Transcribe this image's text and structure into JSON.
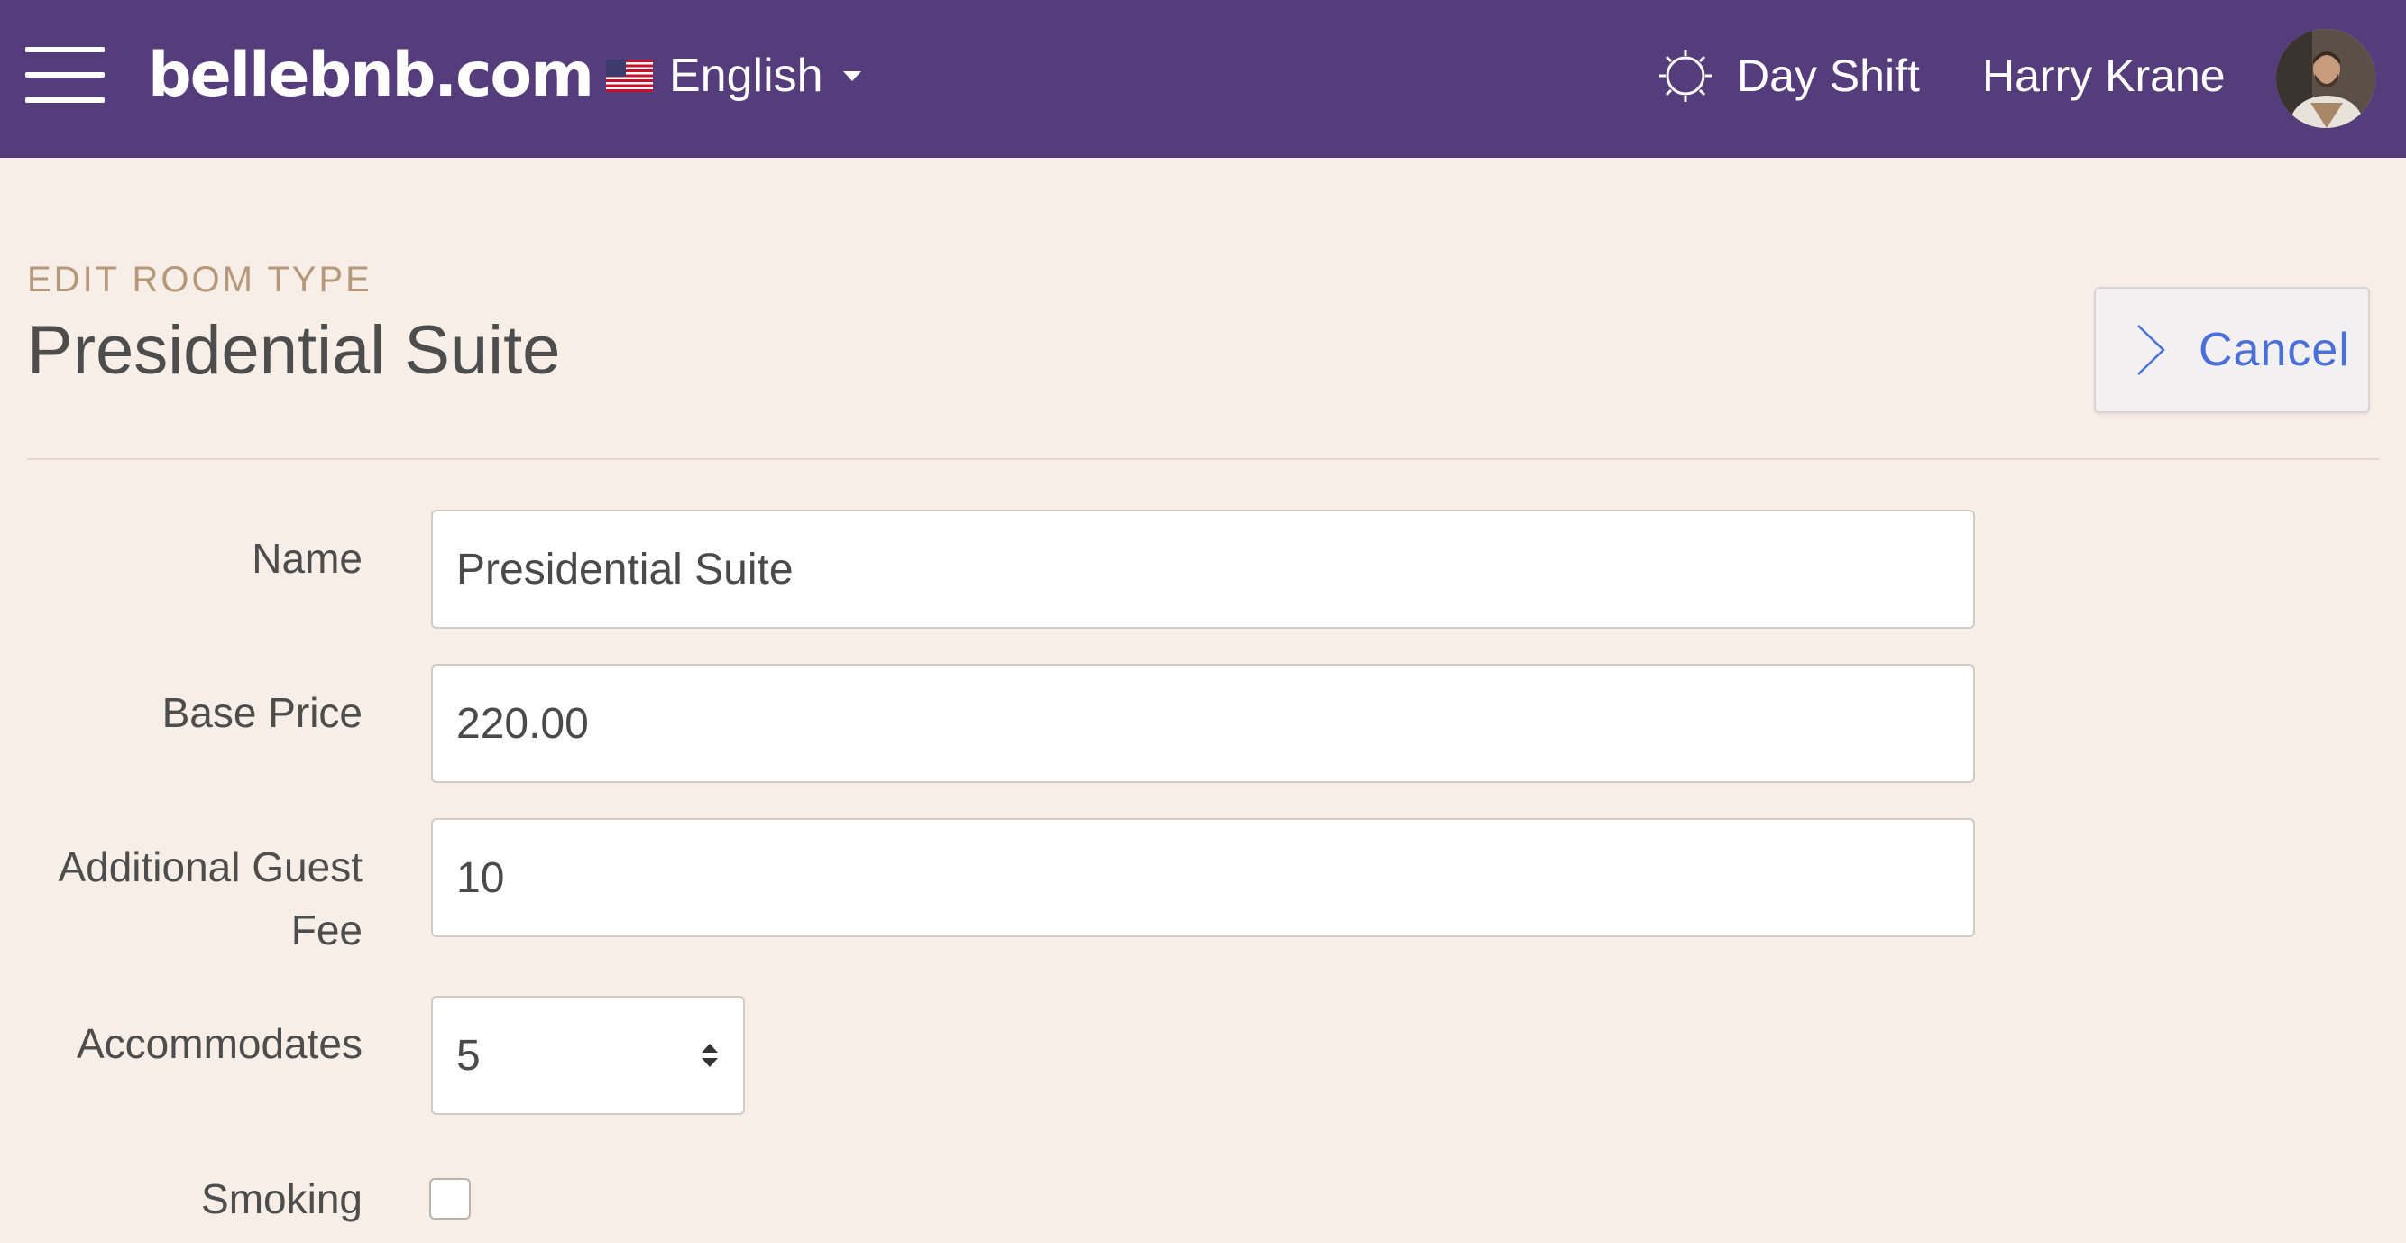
{
  "header": {
    "brand": "bellebnb.com",
    "language": "English",
    "shift": "Day Shift",
    "user_name": "Harry Krane",
    "icons": {
      "menu": "hamburger-menu-icon",
      "flag": "us-flag-icon",
      "shift": "sun-icon",
      "avatar": "user-avatar"
    },
    "colors": {
      "bar": "#553c7b",
      "text": "#ffffff"
    }
  },
  "page": {
    "eyebrow": "EDIT ROOM TYPE",
    "title": "Presidential Suite",
    "cancel_label": "Cancel",
    "colors": {
      "background": "#f7eee7",
      "accent": "#4a6fd8",
      "eyebrow": "#b5977a"
    }
  },
  "form": {
    "name": {
      "label": "Name",
      "value": "Presidential Suite"
    },
    "base_price": {
      "label": "Base Price",
      "value": "220.00"
    },
    "additional_guest_fee": {
      "label_line1": "Additional Guest",
      "label_line2": "Fee",
      "value": "10"
    },
    "accommodates": {
      "label": "Accommodates",
      "value": "5"
    },
    "smoking": {
      "label": "Smoking",
      "checked": false
    }
  }
}
